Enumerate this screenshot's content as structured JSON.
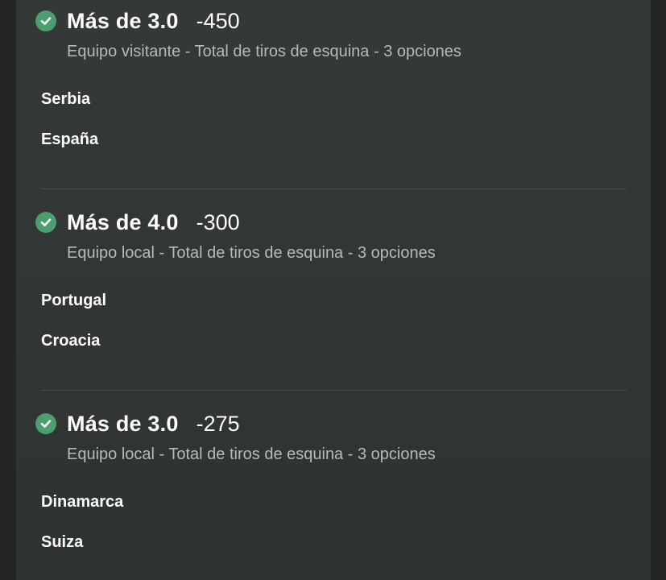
{
  "bets": [
    {
      "line": "Más de 3.0",
      "odds": "-450",
      "market": "Equipo visitante - Total de tiros de esquina - 3 opciones",
      "picks": [
        "Serbia",
        "España"
      ],
      "status_icon": "check-circle-icon",
      "status_color": "#4d9e6f"
    },
    {
      "line": "Más de 4.0",
      "odds": "-300",
      "market": "Equipo local - Total de tiros de esquina - 3 opciones",
      "picks": [
        "Portugal",
        "Croacia"
      ],
      "status_icon": "check-circle-icon",
      "status_color": "#4d9e6f"
    },
    {
      "line": "Más de 3.0",
      "odds": "-275",
      "market": "Equipo local - Total de tiros de esquina - 3 opciones",
      "picks": [
        "Dinamarca",
        "Suiza"
      ],
      "status_icon": "check-circle-icon",
      "status_color": "#4d9e6f"
    }
  ]
}
